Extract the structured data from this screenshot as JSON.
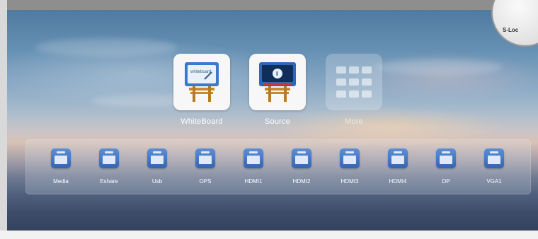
{
  "home_apps": [
    {
      "label": "WhiteBoard",
      "icon": "whiteboard-easel-icon"
    },
    {
      "label": "Source",
      "icon": "source-easel-icon"
    },
    {
      "label": "More",
      "icon": "app-grid-icon"
    }
  ],
  "dock": {
    "items": [
      {
        "label": "Media",
        "icon": "usb-media-icon"
      },
      {
        "label": "Eshare",
        "icon": "eshare-icon"
      },
      {
        "label": "Usb",
        "icon": "usb-drive-icon"
      },
      {
        "label": "OPS",
        "icon": "windows-icon"
      },
      {
        "label": "HDMI1",
        "icon": "hdmi-icon"
      },
      {
        "label": "HDMI2",
        "icon": "hdmi-icon"
      },
      {
        "label": "HDMI3",
        "icon": "hdmi-icon"
      },
      {
        "label": "HDMI4",
        "icon": "hdmi-icon"
      },
      {
        "label": "DP",
        "icon": "displayport-icon"
      },
      {
        "label": "VGA1",
        "icon": "vga-icon"
      }
    ]
  },
  "corner_widget": {
    "label": "S-Loc"
  },
  "colors": {
    "accent_blue": "#3466b0",
    "tile_bg": "#f7f7f7"
  }
}
